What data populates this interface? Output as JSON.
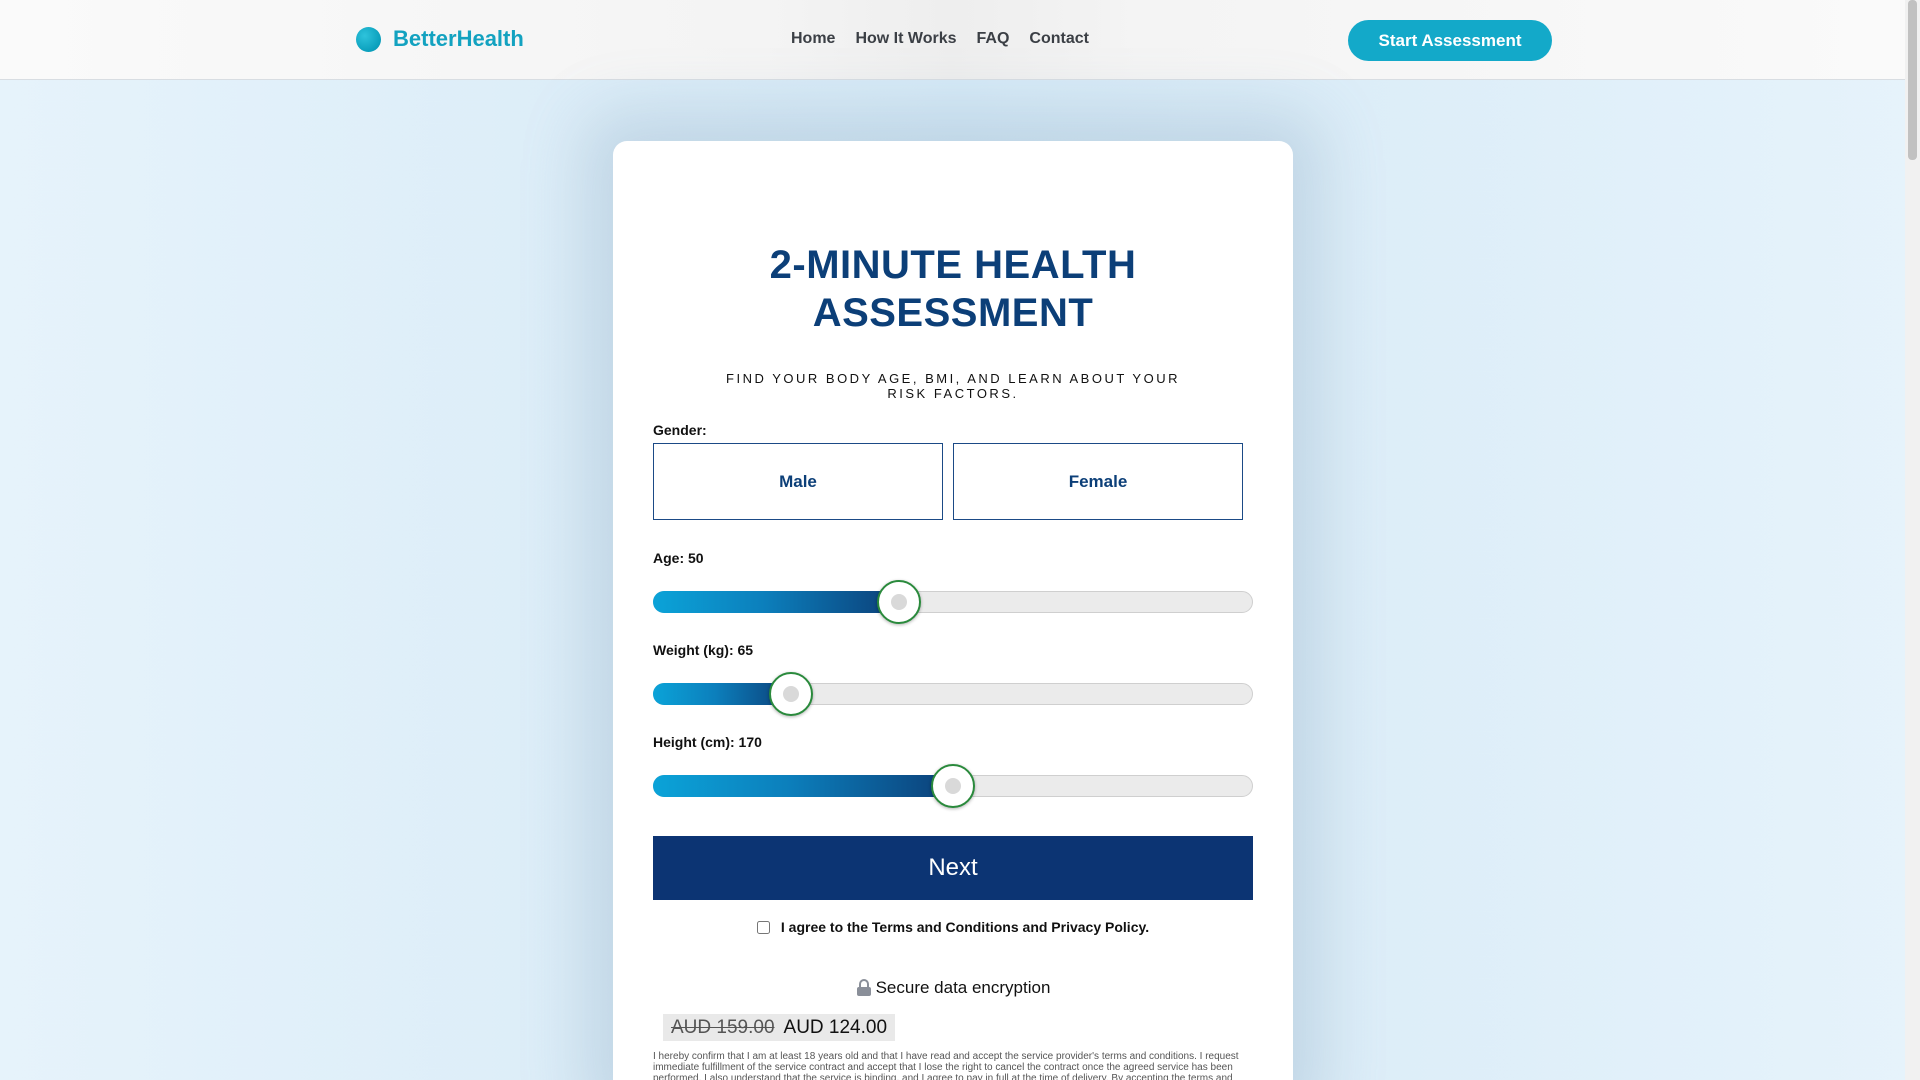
{
  "header": {
    "brand": "BetterHealth",
    "nav": [
      "Home",
      "How It Works",
      "FAQ",
      "Contact"
    ],
    "cta": "Start Assessment"
  },
  "card": {
    "title_line1": "2-MINUTE HEALTH",
    "title_line2": "ASSESSMENT",
    "subtitle": "FIND YOUR BODY AGE, BMI, AND LEARN ABOUT YOUR RISK FACTORS.",
    "gender_label": "Gender:",
    "gender_options": [
      "Male",
      "Female"
    ],
    "age_label": "Age: 50",
    "weight_label": "Weight (kg): 65",
    "height_label": "Height (cm): 170",
    "sliders": {
      "age_fraction": 0.41,
      "weight_fraction": 0.23,
      "height_fraction": 0.5
    },
    "next": "Next",
    "agree": "I agree to the Terms and Conditions and Privacy Policy.",
    "secure": "Secure data encryption",
    "price_old": "AUD 159.00",
    "price_new": "AUD 124.00",
    "fine_print": "I hereby confirm that I am at least 18 years old and that I have read and accept the service provider's terms and conditions. I request immediate fulfillment of the service contract and accept that I lose the right to cancel the contract once the agreed service has been performed. I also understand that the service is binding, and I agree to pay in full at the time of delivery. By accepting the terms and"
  },
  "colors": {
    "brand": "#13a2c0",
    "title": "#0c3f78",
    "next_button": "#0c3473",
    "thumb_border": "#2a8a3c"
  },
  "icons": {
    "lock": "lock-icon",
    "logo": "logo-dot-icon"
  }
}
